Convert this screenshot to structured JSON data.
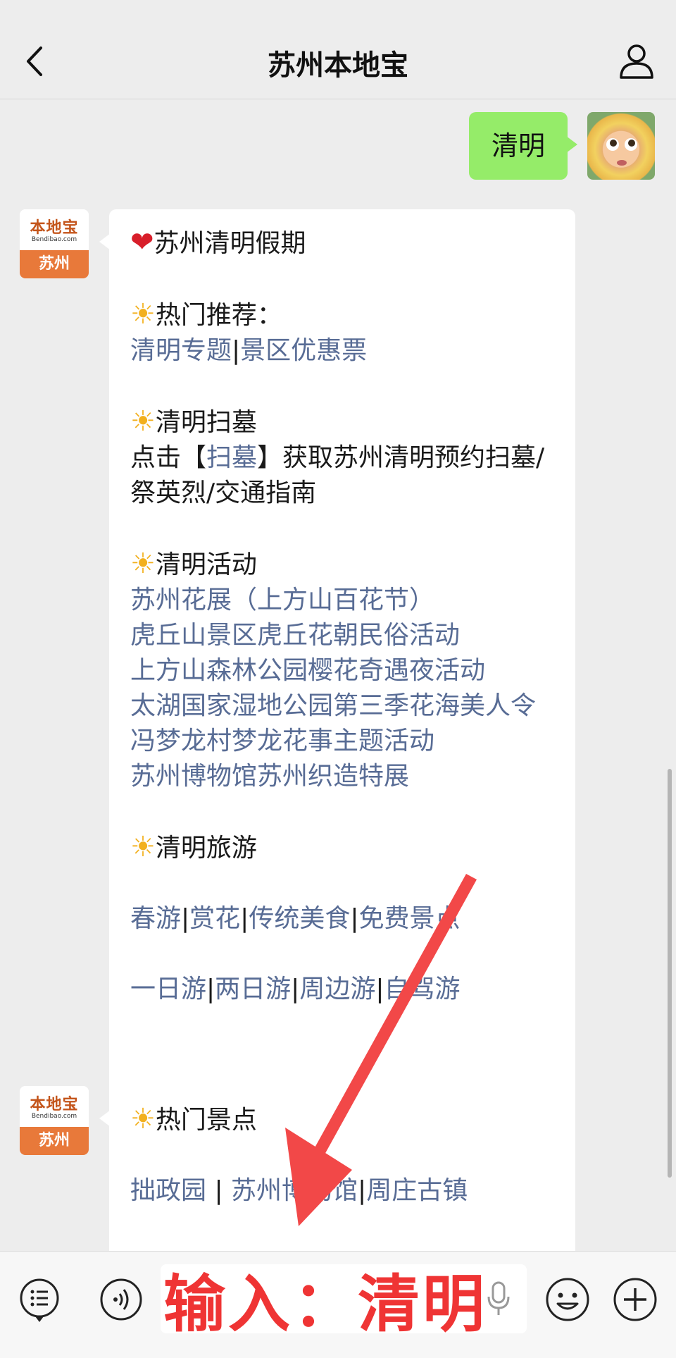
{
  "header": {
    "title": "苏州本地宝"
  },
  "user_message": {
    "text": "清明"
  },
  "bot_avatar": {
    "brand": "本地宝",
    "url": "Bendibao.com",
    "city": "苏州"
  },
  "message1": {
    "title": "苏州清明假期",
    "s1_title": "热门推荐：",
    "s1_links": [
      "清明专题",
      "景区优惠票"
    ],
    "s2_title": "清明扫墓",
    "s2_pre": "点击【",
    "s2_link": "扫墓",
    "s2_post": "】获取苏州清明预约扫墓/祭英烈/交通指南",
    "s3_title": "清明活动",
    "s3_links": [
      "苏州花展（上方山百花节）",
      "虎丘山景区虎丘花朝民俗活动",
      "上方山森林公园樱花奇遇夜活动",
      "太湖国家湿地公园第三季花海美人令",
      "冯梦龙村梦龙花事主题活动",
      "苏州博物馆苏州织造特展"
    ],
    "s4_title": "清明旅游",
    "s4_links_row1": [
      "春游",
      "赏花",
      "传统美食",
      "免费景点"
    ],
    "s4_links_row2": [
      "一日游",
      "两日游",
      "周边游",
      "自驾游"
    ]
  },
  "message2": {
    "title": "热门景点",
    "links": [
      "拙政园",
      "苏州博物馆",
      "周庄古镇"
    ]
  },
  "overlay": {
    "text": "输入：清明"
  },
  "colors": {
    "link": "#586c95",
    "user_bubble": "#95ec69",
    "arrow": "#f24848"
  }
}
